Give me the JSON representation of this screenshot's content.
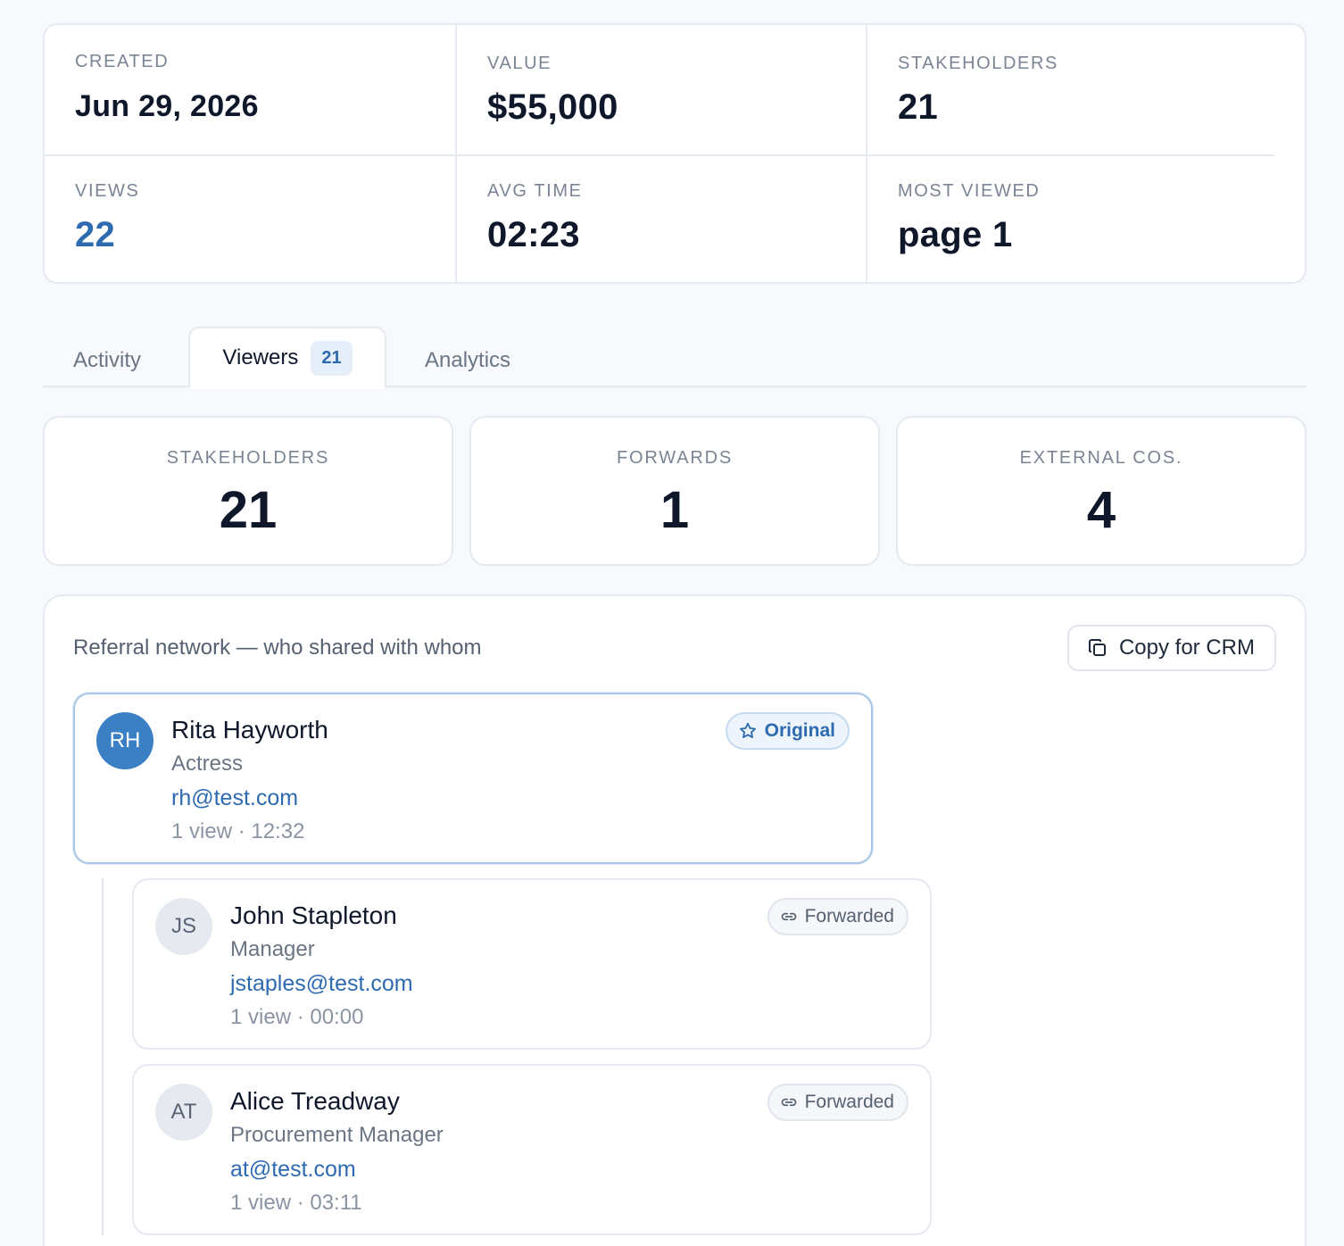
{
  "stats": {
    "created": {
      "label": "CREATED",
      "value": "Jun 29, 2026"
    },
    "value": {
      "label": "VALUE",
      "value": "$55,000"
    },
    "stakeholders": {
      "label": "STAKEHOLDERS",
      "value": "21"
    },
    "views": {
      "label": "VIEWS",
      "value": "22"
    },
    "avg_time": {
      "label": "AVG TIME",
      "value": "02:23"
    },
    "most_viewed": {
      "label": "MOST VIEWED",
      "value": "page 1"
    }
  },
  "tabs": {
    "activity": "Activity",
    "viewers": "Viewers",
    "viewers_count": "21",
    "analytics": "Analytics"
  },
  "summary": {
    "stakeholders": {
      "label": "STAKEHOLDERS",
      "value": "21"
    },
    "forwards": {
      "label": "FORWARDS",
      "value": "1"
    },
    "external": {
      "label": "EXTERNAL COS.",
      "value": "4"
    }
  },
  "referral": {
    "title": "Referral network — who shared with whom",
    "copy_label": "Copy for CRM",
    "people": [
      {
        "initials": "RH",
        "name": "Rita Hayworth",
        "role": "Actress",
        "email": "rh@test.com",
        "meta": "1 view · 12:32",
        "tag": "Original"
      },
      {
        "initials": "JS",
        "name": "John Stapleton",
        "role": "Manager",
        "email": "jstaples@test.com",
        "meta": "1 view · 00:00",
        "tag": "Forwarded"
      },
      {
        "initials": "AT",
        "name": "Alice Treadway",
        "role": "Procurement Manager",
        "email": "at@test.com",
        "meta": "1 view · 03:11",
        "tag": "Forwarded"
      }
    ]
  },
  "colors": {
    "accent": "#2e6ab0",
    "avatar_primary": "#3b7fc4",
    "background": "#f7f9fc"
  }
}
